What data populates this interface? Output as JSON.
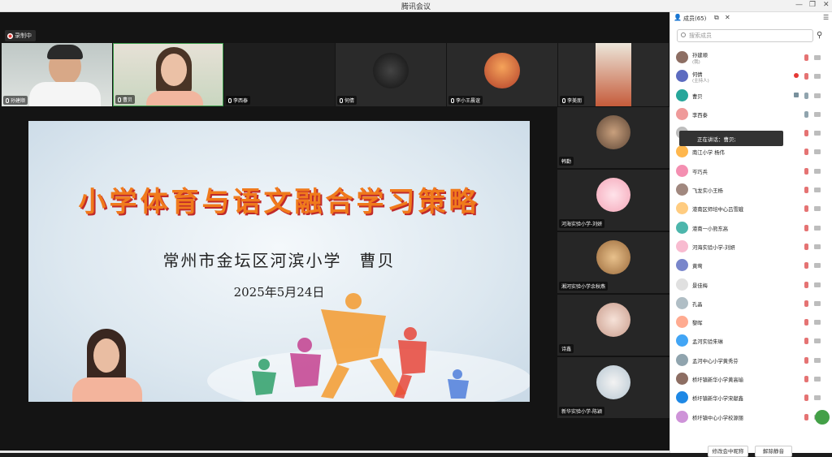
{
  "window": {
    "title": "腾讯会议"
  },
  "toolbar": {
    "record_label": "录制中"
  },
  "video_tiles": [
    {
      "name": "孙建顺"
    },
    {
      "name": "曹贝"
    },
    {
      "name": "李西泰"
    },
    {
      "name": "何倩"
    },
    {
      "name": "李小王晨谊"
    },
    {
      "name": "李美朋"
    }
  ],
  "side_tiles": [
    {
      "name": "韩勤"
    },
    {
      "name": "河海实验小学-刘妍"
    },
    {
      "name": "湘河实验小学余秋燕"
    },
    {
      "name": "诗鑫"
    },
    {
      "name": "新华实验小学-陈颖"
    }
  ],
  "slide": {
    "title": "小学体育与语文融合学习策略",
    "subtitle": "常州市金坛区河滨小学　曹贝",
    "date": "2025年5月24日"
  },
  "panel": {
    "title": "成员(65)",
    "search_placeholder": "搜索成员",
    "members": [
      {
        "name": "孙建顺",
        "sub": "(我)"
      },
      {
        "name": "何倩",
        "sub": "(主持人)"
      },
      {
        "name": "曹贝",
        "sub": ""
      },
      {
        "name": "李西泰",
        "sub": ""
      },
      {
        "name": "",
        "sub": ""
      },
      {
        "name": "南江小学 杨伟",
        "sub": ""
      },
      {
        "name": "岑巧兵",
        "sub": ""
      },
      {
        "name": "飞龙实小王杨",
        "sub": ""
      },
      {
        "name": "港南区师培中心吕雪娥",
        "sub": ""
      },
      {
        "name": "港南一小熊东高",
        "sub": ""
      },
      {
        "name": "河海实验小学-刘妍",
        "sub": ""
      },
      {
        "name": "黄莺",
        "sub": ""
      },
      {
        "name": "景佳梅",
        "sub": ""
      },
      {
        "name": "孔晶",
        "sub": ""
      },
      {
        "name": "黎晖",
        "sub": ""
      },
      {
        "name": "孟河实验朱琳",
        "sub": ""
      },
      {
        "name": "孟河中心小学黄秀芬",
        "sub": ""
      },
      {
        "name": "桥圩镇新华小学黄高瑜",
        "sub": ""
      },
      {
        "name": "桥圩镇新华小学宋献鑫",
        "sub": ""
      },
      {
        "name": "桥圩镇中心小学校源丽",
        "sub": ""
      }
    ],
    "speaking_label": "正在讲话：曹贝;",
    "rename_button": "修改会中昵称",
    "unmute_button": "解除静音"
  },
  "colors": {
    "record_dot": "#e53935",
    "slide_title": "#f07a1c",
    "mic_muted": "#e57373"
  }
}
